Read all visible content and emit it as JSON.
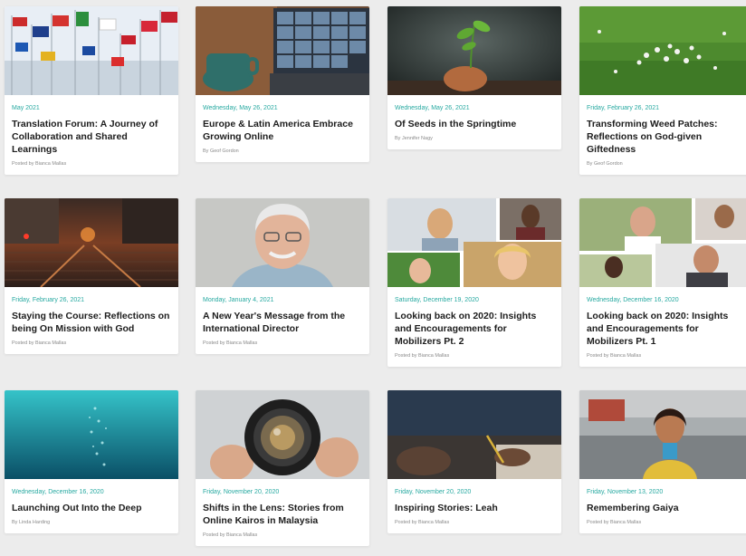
{
  "cards": [
    {
      "date": "May 2021",
      "title": "Translation Forum: A Journey of Collaboration and Shared Learnings",
      "byline": "Posted by Bianca Mallas",
      "image": "flags-photo"
    },
    {
      "date": "Wednesday, May 26, 2021",
      "title": "Europe & Latin America Embrace Growing Online",
      "byline": "By Geof Gordon",
      "image": "video-call-laptop-photo"
    },
    {
      "date": "Wednesday, May 26, 2021",
      "title": "Of Seeds in the Springtime",
      "byline": "By Jennifer Nagy",
      "image": "seedling-photo"
    },
    {
      "date": "Friday, February 26, 2021",
      "title": "Transforming Weed Patches: Reflections on God-given Giftedness",
      "byline": "By Geof Gordon",
      "image": "weeds-flowers-photo"
    },
    {
      "date": "Friday, February 26, 2021",
      "title": "Staying the Course: Reflections on being On Mission with God",
      "byline": "Posted by Bianca Mallas",
      "image": "cobblestone-street-photo"
    },
    {
      "date": "Monday, January 4, 2021",
      "title": "A New Year's Message from the International Director",
      "byline": "Posted by Bianca Mallas",
      "image": "director-portrait-photo"
    },
    {
      "date": "Saturday, December 19, 2020",
      "title": "Looking back on 2020: Insights and Encouragements for Mobilizers Pt. 2",
      "byline": "Posted by Bianca Mallas",
      "image": "portrait-collage-photo"
    },
    {
      "date": "Wednesday, December 16, 2020",
      "title": "Looking back on 2020: Insights and Encouragements for Mobilizers Pt. 1",
      "byline": "Posted by Bianca Mallas",
      "image": "portrait-collage-photo-2"
    },
    {
      "date": "Wednesday, December 16, 2020",
      "title": "Launching Out Into the Deep",
      "byline": "By Linda Harding",
      "image": "underwater-photo"
    },
    {
      "date": "Friday, November 20, 2020",
      "title": "Shifts in the Lens: Stories from Online Kairos in Malaysia",
      "byline": "Posted by Bianca Mallas",
      "image": "camera-lens-photo"
    },
    {
      "date": "Friday, November 20, 2020",
      "title": "Inspiring Stories: Leah",
      "byline": "Posted by Bianca Mallas",
      "image": "writing-hands-photo"
    },
    {
      "date": "Friday, November 13, 2020",
      "title": "Remembering Gaiya",
      "byline": "Posted by Bianca Mallas",
      "image": "woman-street-photo"
    }
  ]
}
